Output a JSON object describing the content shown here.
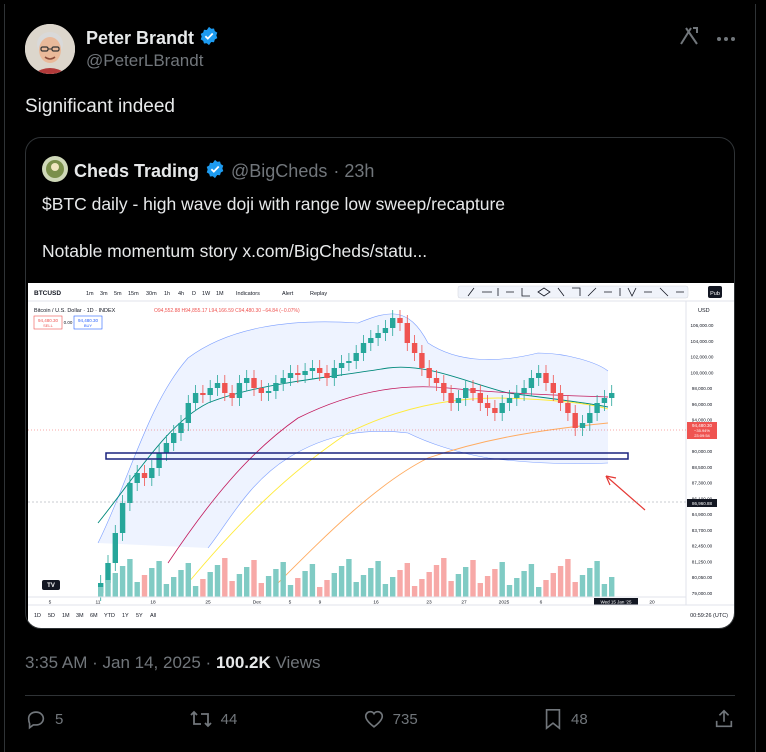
{
  "author": {
    "name": "Peter Brandt",
    "handle": "@PeterLBrandt"
  },
  "tweet": {
    "text": "Significant indeed"
  },
  "quoted": {
    "name": "Cheds Trading",
    "handle": "@BigCheds",
    "age": "· 23h",
    "line1": "$BTC daily - high wave doji with range low sweep/recapture",
    "line2": "Notable momentum story  x.com/BigCheds/statu...",
    "chart": {
      "symbol": "BTCUSD",
      "title": "Bitcoin / U.S. Dollar · 1D · INDEX",
      "ohlc": "O94,552.88 H94,855.17 L94,166.59 C94,480.30 −64.84 (−0.07%)",
      "sell_label": "SELL",
      "buy_label": "BUY",
      "sell_price": "94,480.30",
      "buy_price": "94,480.30",
      "spread": "0.00",
      "toolbar": [
        "1m",
        "3m",
        "5m",
        "15m",
        "30m",
        "1h",
        "4h",
        "D",
        "1W",
        "1M",
        "Indicators",
        "Alert",
        "Replay"
      ],
      "price_axis": [
        "106,000.00",
        "104,000.00",
        "102,000.00",
        "100,000.00",
        "98,000.00",
        "96,000.00",
        "94,000.00",
        "92,000.00",
        "90,000.00",
        "88,500.00",
        "87,300.00",
        "86,100.00",
        "84,900.00",
        "83,700.00",
        "82,450.00",
        "81,250.00",
        "80,050.00",
        "79,000.00"
      ],
      "current_price_tag": "94,480.30",
      "current_price_sub": "−35.94%",
      "current_time_tag": "23:09:54",
      "level_tag": "86,960.88",
      "x_axis": [
        "5",
        "11",
        "18",
        "25",
        "Dec",
        "5",
        "9",
        "16",
        "23",
        "27",
        "2025",
        "6",
        "Wed 15 Jan '25",
        "20"
      ],
      "ranges": [
        "1D",
        "5D",
        "1M",
        "3M",
        "6M",
        "YTD",
        "1Y",
        "5Y",
        "All"
      ],
      "clock": "00:59:26 (UTC)",
      "logo_text": "TV",
      "currency": "USD",
      "mode_label": "Pub",
      "colors": {
        "up": "#26a69a",
        "down": "#ef5350",
        "vol_up": "#80cbc4",
        "vol_down": "#f7a9a7",
        "bb": "#2962ff",
        "ma_fast": "#00897b",
        "ma_slow": "#c2185b",
        "ma_yellow": "#ffeb3b",
        "ma_orange": "#ffab60",
        "box": "#1a237e",
        "arrow": "#e53935"
      }
    }
  },
  "meta": {
    "time": "3:35 AM",
    "date": "Jan 14, 2025",
    "views_count": "100.2K",
    "views_label": "Views"
  },
  "actions": {
    "replies": "5",
    "reposts": "44",
    "likes": "735",
    "bookmarks": "48"
  },
  "colors": {
    "background": "#000000",
    "text": "#e7e9ea",
    "muted": "#71767b",
    "verified": "#1d9bf0",
    "border": "#2f3336"
  }
}
